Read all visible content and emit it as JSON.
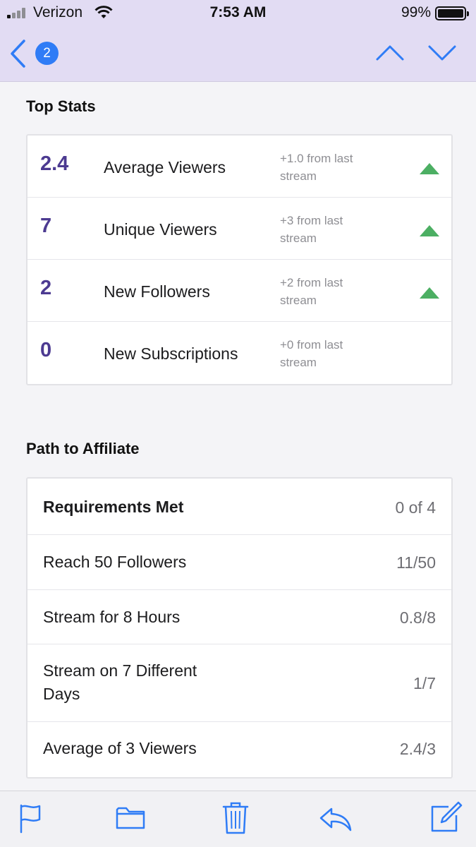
{
  "status_bar": {
    "carrier": "Verizon",
    "time": "7:53 AM",
    "battery": "99%",
    "battery_level": 0.99
  },
  "nav": {
    "badge_count": "2"
  },
  "top_stats": {
    "title": "Top Stats",
    "rows": [
      {
        "value": "2.4",
        "label": "Average Viewers",
        "change": "+1.0 from last stream",
        "trend": "up"
      },
      {
        "value": "7",
        "label": "Unique Viewers",
        "change": "+3 from last stream",
        "trend": "up"
      },
      {
        "value": "2",
        "label": "New Followers",
        "change": "+2 from last stream",
        "trend": "up"
      },
      {
        "value": "0",
        "label": "New Subscriptions",
        "change": "+0 from last stream",
        "trend": "none"
      }
    ]
  },
  "affiliate": {
    "title": "Path to Affiliate",
    "header": {
      "label": "Requirements Met",
      "value": "0 of 4"
    },
    "rows": [
      {
        "label": "Reach 50 Followers",
        "value": "11/50"
      },
      {
        "label": "Stream for 8 Hours",
        "value": "0.8/8"
      },
      {
        "label": "Stream on 7 Different Days",
        "value": "1/7"
      },
      {
        "label": "Average of 3 Viewers",
        "value": "2.4/3"
      }
    ]
  },
  "colors": {
    "accent": "#2f7cf6",
    "stat_value": "#4c3a91",
    "trend_up": "#4caf63",
    "header_bg": "#e2dcf3"
  }
}
